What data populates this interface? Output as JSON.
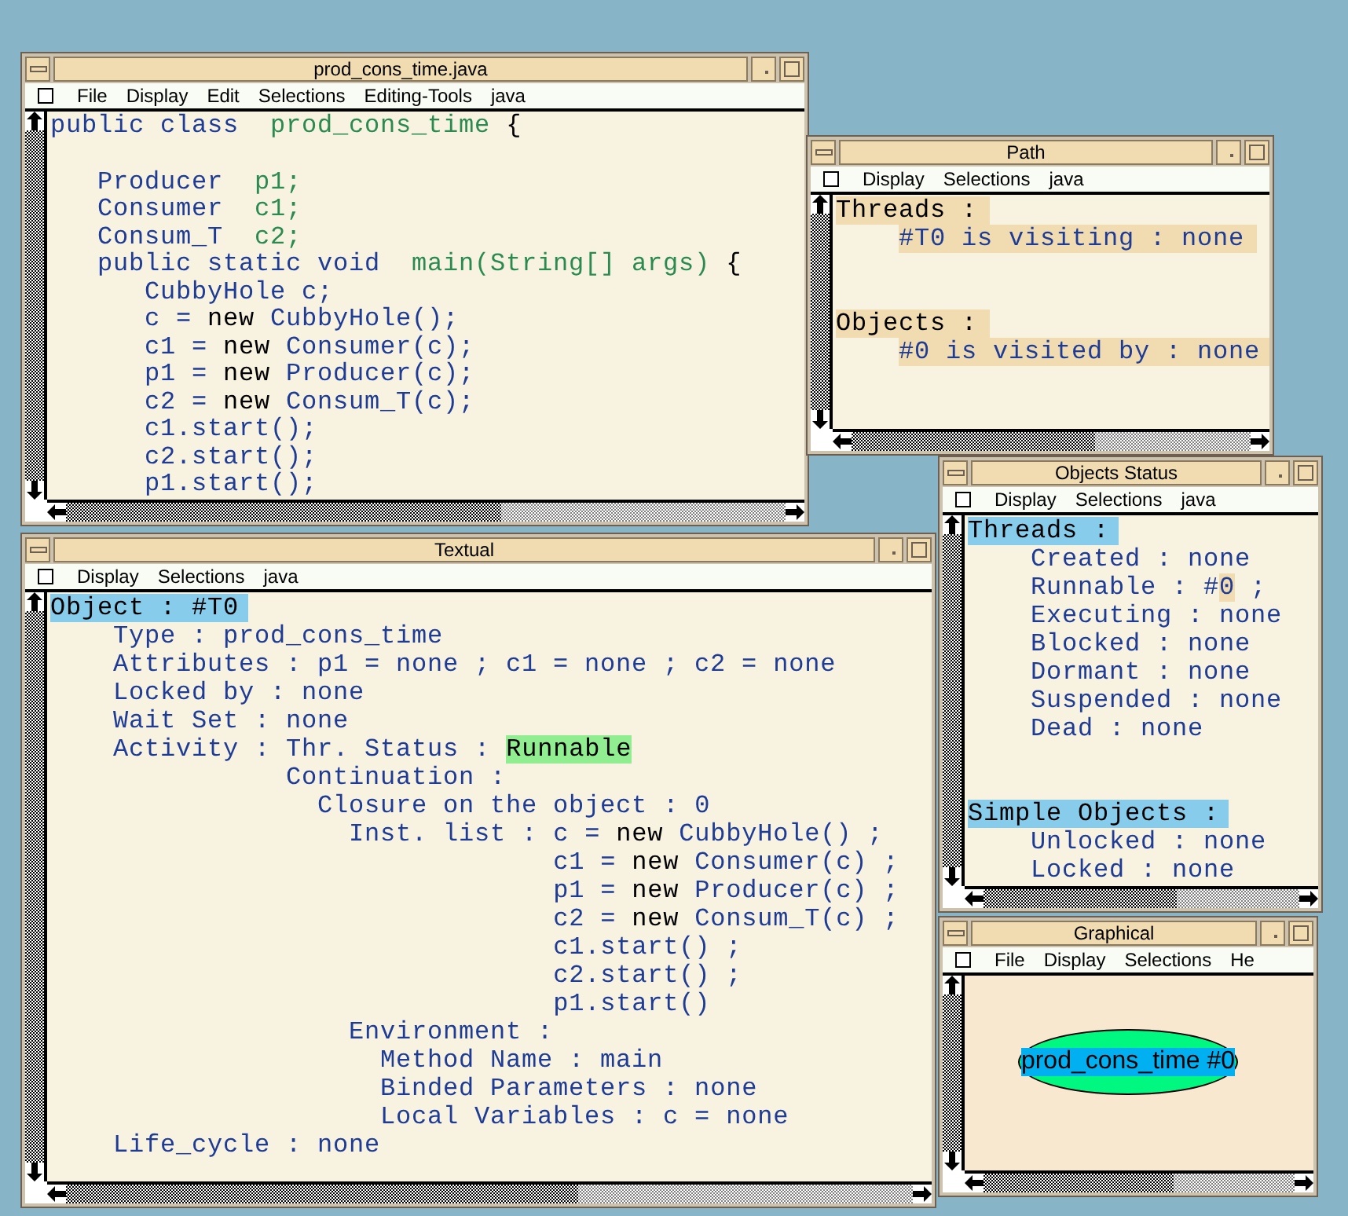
{
  "windows": [
    {
      "title": "prod_cons_time.java",
      "kind": "code",
      "menu": [
        "File",
        "Display",
        "Edit",
        "Selections",
        "Editing-Tools",
        "java"
      ],
      "lines": [
        {
          "segments": [
            {
              "text": "public class  ",
              "kind": "keyword"
            },
            {
              "text": "prod_cons_time",
              "kind": "name"
            },
            {
              "text": " {",
              "kind": "plain"
            }
          ],
          "children": [
            {
              "spaced": true,
              "segments": [
                {
                  "text": "Producer  ",
                  "kind": "keyword"
                },
                {
                  "text": "p1;",
                  "kind": "name"
                }
              ]
            },
            {
              "segments": [
                {
                  "text": "Consumer  ",
                  "kind": "keyword"
                },
                {
                  "text": "c1;",
                  "kind": "name"
                }
              ]
            },
            {
              "segments": [
                {
                  "text": "Consum_T  ",
                  "kind": "keyword"
                },
                {
                  "text": "c2;",
                  "kind": "name"
                }
              ]
            },
            {
              "segments": [
                {
                  "text": "public static void  ",
                  "kind": "keyword"
                },
                {
                  "text": "main(String[] args)",
                  "kind": "name"
                },
                {
                  "text": " {",
                  "kind": "plain"
                }
              ],
              "children": [
                {
                  "segments": [
                    {
                      "text": "CubbyHole c;",
                      "kind": "keyword"
                    }
                  ]
                },
                {
                  "segments": [
                    {
                      "text": "c = ",
                      "kind": "keyword"
                    },
                    {
                      "text": "new",
                      "kind": "plain"
                    },
                    {
                      "text": " CubbyHole();",
                      "kind": "keyword"
                    }
                  ]
                },
                {
                  "segments": [
                    {
                      "text": "c1 = ",
                      "kind": "keyword"
                    },
                    {
                      "text": "new",
                      "kind": "plain"
                    },
                    {
                      "text": " Consumer(c);",
                      "kind": "keyword"
                    }
                  ]
                },
                {
                  "segments": [
                    {
                      "text": "p1 = ",
                      "kind": "keyword"
                    },
                    {
                      "text": "new",
                      "kind": "plain"
                    },
                    {
                      "text": " Producer(c);",
                      "kind": "keyword"
                    }
                  ]
                },
                {
                  "segments": [
                    {
                      "text": "c2 = ",
                      "kind": "keyword"
                    },
                    {
                      "text": "new",
                      "kind": "plain"
                    },
                    {
                      "text": " Consum_T(c);",
                      "kind": "keyword"
                    }
                  ]
                },
                {
                  "segments": [
                    {
                      "text": "c1.start();",
                      "kind": "keyword"
                    }
                  ]
                },
                {
                  "segments": [
                    {
                      "text": "c2.start();",
                      "kind": "keyword"
                    }
                  ]
                },
                {
                  "segments": [
                    {
                      "text": "p1.start();",
                      "kind": "keyword"
                    }
                  ]
                }
              ]
            }
          ]
        }
      ]
    },
    {
      "title": "Path",
      "kind": "path",
      "menu": [
        "Display",
        "Selections",
        "java"
      ],
      "lines": [
        {
          "text": "Threads :",
          "kind": "heading",
          "highlighted": true,
          "children": [
            {
              "text": "#T0 is visiting : none",
              "kind": "entry",
              "highlighted": true
            }
          ]
        },
        {
          "text": "Objects :",
          "kind": "heading",
          "highlighted": true,
          "spaced": true,
          "children": [
            {
              "text": "#0 is visited by : none",
              "kind": "entry",
              "highlighted": true
            }
          ]
        }
      ]
    },
    {
      "title": "Objects Status",
      "kind": "outline",
      "menu": [
        "Display",
        "Selections",
        "java"
      ],
      "lines": [
        {
          "text": "Threads :",
          "kind": "heading",
          "highlighted": true,
          "children": [
            {
              "text": "Created : none",
              "kind": "entry"
            },
            {
              "segments": [
                {
                  "text": "Runnable : #",
                  "kind": "keyword"
                },
                {
                  "text": "0",
                  "kind": "ref"
                },
                {
                  "text": " ;",
                  "kind": "keyword"
                }
              ]
            },
            {
              "text": "Executing : none",
              "kind": "entry"
            },
            {
              "text": "Blocked : none",
              "kind": "entry"
            },
            {
              "text": "Dormant : none",
              "kind": "entry"
            },
            {
              "text": "Suspended : none",
              "kind": "entry"
            },
            {
              "text": "Dead : none",
              "kind": "entry"
            }
          ]
        },
        {
          "text": "Simple Objects :",
          "kind": "heading",
          "highlighted": true,
          "spaced": true,
          "children": [
            {
              "text": "Unlocked : none",
              "kind": "entry"
            },
            {
              "text": "Locked : none",
              "kind": "entry"
            }
          ]
        }
      ]
    },
    {
      "title": "Textual",
      "kind": "outline",
      "menu": [
        "Display",
        "Selections",
        "java"
      ],
      "lines": [
        {
          "text": "Object : #T0",
          "kind": "heading",
          "highlighted": true,
          "children": [
            {
              "text": "Type : prod_cons_time",
              "kind": "entry"
            },
            {
              "text": "Attributes : p1 = none ; c1 = none ; c2 = none",
              "kind": "entry"
            },
            {
              "text": "Locked by : none",
              "kind": "entry"
            },
            {
              "text": "Wait Set : none",
              "kind": "entry"
            },
            {
              "text": "Activity : ",
              "kind": "entry",
              "column": [
                {
                  "segments": [
                    {
                      "text": "Thr. Status : ",
                      "kind": "keyword"
                    },
                    {
                      "text": "Runnable",
                      "kind": "status"
                    }
                  ]
                },
                {
                  "text": "Continuation :",
                  "kind": "entry",
                  "children": [
                    {
                      "text": "Closure on the object : 0",
                      "kind": "entry",
                      "children": [
                        {
                          "text": "Inst. list : ",
                          "kind": "entry",
                          "column": [
                            {
                              "segments": [
                                {
                                  "text": "c = ",
                                  "kind": "keyword"
                                },
                                {
                                  "text": "new",
                                  "kind": "plain"
                                },
                                {
                                  "text": " CubbyHole() ;",
                                  "kind": "keyword"
                                }
                              ]
                            },
                            {
                              "segments": [
                                {
                                  "text": "c1 = ",
                                  "kind": "keyword"
                                },
                                {
                                  "text": "new",
                                  "kind": "plain"
                                },
                                {
                                  "text": " Consumer(c) ;",
                                  "kind": "keyword"
                                }
                              ]
                            },
                            {
                              "segments": [
                                {
                                  "text": "p1 = ",
                                  "kind": "keyword"
                                },
                                {
                                  "text": "new",
                                  "kind": "plain"
                                },
                                {
                                  "text": " Producer(c) ;",
                                  "kind": "keyword"
                                }
                              ]
                            },
                            {
                              "segments": [
                                {
                                  "text": "c2 = ",
                                  "kind": "keyword"
                                },
                                {
                                  "text": "new",
                                  "kind": "plain"
                                },
                                {
                                  "text": " Consum_T(c) ;",
                                  "kind": "keyword"
                                }
                              ]
                            },
                            {
                              "text": "c1.start() ;",
                              "kind": "entry"
                            },
                            {
                              "text": "c2.start() ;",
                              "kind": "entry"
                            },
                            {
                              "text": "p1.start()",
                              "kind": "entry"
                            }
                          ]
                        },
                        {
                          "text": "Environment :",
                          "kind": "entry",
                          "children": [
                            {
                              "text": "Method Name : main",
                              "kind": "entry"
                            },
                            {
                              "text": "Binded Parameters : none",
                              "kind": "entry"
                            },
                            {
                              "text": "Local Variables : c = none",
                              "kind": "entry"
                            }
                          ]
                        }
                      ]
                    }
                  ]
                }
              ]
            },
            {
              "text": "Life_cycle : none",
              "kind": "entry"
            }
          ]
        }
      ]
    },
    {
      "title": "Graphical",
      "kind": "graph",
      "menu": [
        "File",
        "Display",
        "Selections",
        "He"
      ],
      "nodes": [
        {
          "label": "prod_cons_time #0",
          "selected": true
        }
      ]
    }
  ]
}
